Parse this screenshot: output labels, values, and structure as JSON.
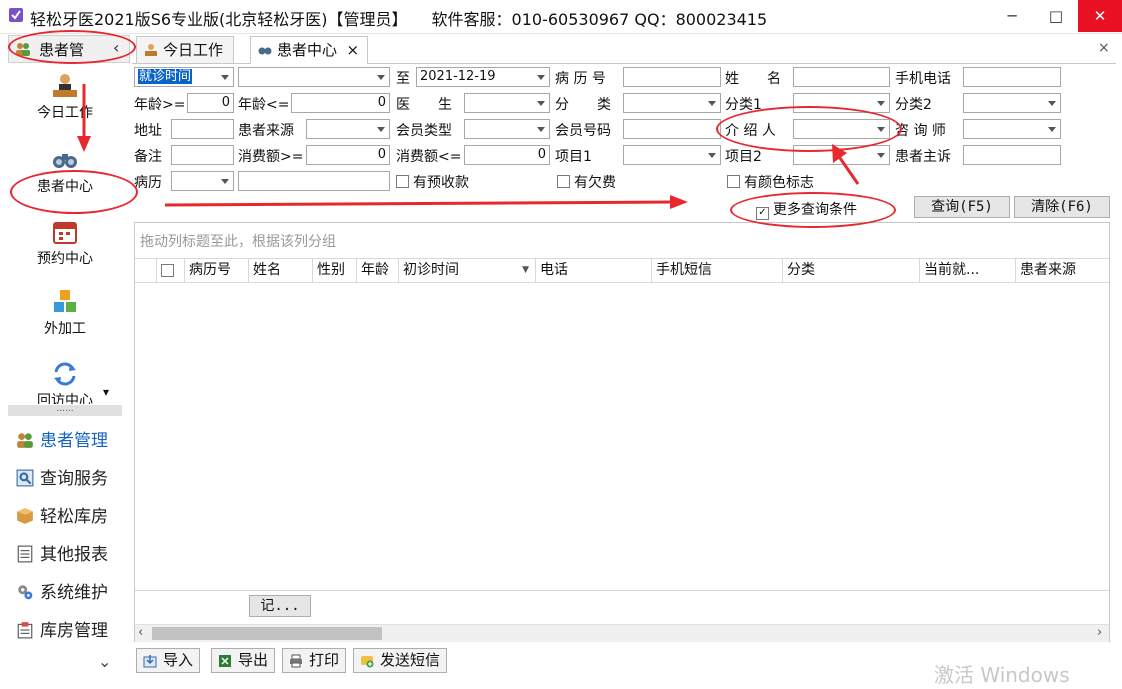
{
  "window": {
    "title": "轻松牙医2021版S6专业版(北京轻松牙医)【管理员】　　软件客服：010-60530967 QQ：800023415",
    "minimize": "─",
    "maximize": "□",
    "close": "✕"
  },
  "nav": {
    "header": "患者管",
    "collapse": "‹",
    "big_items": [
      {
        "label": "今日工作",
        "icon": "person-desk-icon"
      },
      {
        "label": "患者中心",
        "icon": "binoculars-icon"
      },
      {
        "label": "预约中心",
        "icon": "calendar-icon"
      },
      {
        "label": "外加工",
        "icon": "cubes-icon"
      },
      {
        "label": "回访中心",
        "icon": "refresh-icon"
      }
    ],
    "more": "▾",
    "splitter": "......",
    "groups": [
      {
        "label": "患者管理",
        "icon": "users-icon",
        "active": true
      },
      {
        "label": "查询服务",
        "icon": "search-box-icon"
      },
      {
        "label": "轻松库房",
        "icon": "box-icon"
      },
      {
        "label": "其他报表",
        "icon": "report-icon"
      },
      {
        "label": "系统维护",
        "icon": "gears-icon"
      },
      {
        "label": "库房管理",
        "icon": "warehouse-icon"
      }
    ],
    "scroll_down": "⌄"
  },
  "tabs": [
    {
      "label": "今日工作",
      "icon": "person-desk-icon"
    },
    {
      "label": "患者中心",
      "icon": "binoculars-icon",
      "active": true,
      "close": "×"
    }
  ],
  "tabbar_close": "×",
  "filters": {
    "visit_time_select": "就诊时间",
    "date_from": "",
    "to_label": "至",
    "date_to": "2021-12-19",
    "record_no_label": "病 历 号",
    "name_label": "姓　　名",
    "phone_label": "手机电话",
    "age_min_label": "年龄>=",
    "age_min": "0",
    "age_max_label": "年龄<=",
    "age_max": "0",
    "doctor_label": "医　　生",
    "category_label": "分　　类",
    "category1_label": "分类1",
    "category2_label": "分类2",
    "address_label": "地址",
    "source_label": "患者来源",
    "member_type_label": "会员类型",
    "member_no_label": "会员号码",
    "referrer_label": "介 绍 人",
    "consultant_label": "咨 询 师",
    "note_label": "备注",
    "spend_min_label": "消费额>=",
    "spend_min": "0",
    "spend_max_label": "消费额<=",
    "spend_max": "0",
    "item1_label": "项目1",
    "item2_label": "项目2",
    "complaint_label": "患者主诉",
    "history_label": "病历",
    "prepaid_label": "有预收款",
    "arrears_label": "有欠费",
    "color_mark_label": "有颜色标志",
    "more_conditions_label": "更多查询条件",
    "more_conditions_checked": "✓",
    "query_button": "查询(F5)",
    "clear_button": "清除(F6)"
  },
  "grid": {
    "group_hint": "拖动列标题至此，根据该列分组",
    "columns": [
      "",
      "病历号",
      "姓名",
      "性别",
      "年龄",
      "初诊时间",
      "电话",
      "手机短信",
      "分类",
      "当前就...",
      "患者来源"
    ],
    "sort_indicator": "▼",
    "footer_button": "记...",
    "scroll_left": "‹",
    "scroll_right": "›"
  },
  "toolbar": {
    "import": "导入",
    "export": "导出",
    "print": "打印",
    "sms": "发送短信"
  },
  "watermark": "激活 Windows",
  "colors": {
    "accent": "#0a64c8",
    "annotation": "#e8282f",
    "active_nav": "#1565c0"
  }
}
